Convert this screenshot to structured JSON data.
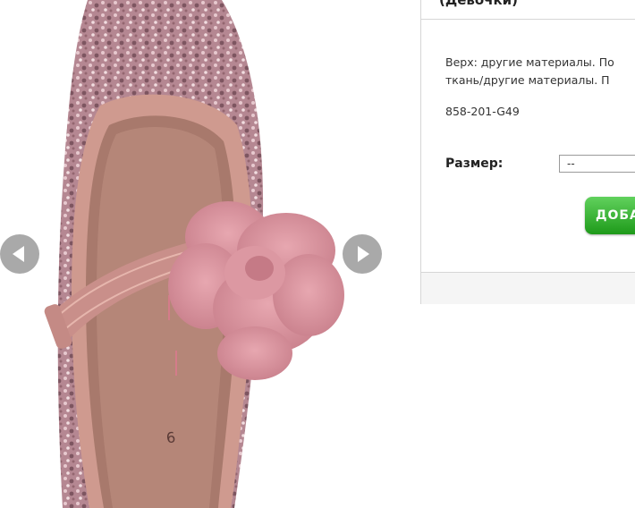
{
  "product": {
    "title": "(Девочки)",
    "description_lines": [
      "Верх: другие материалы. По",
      "ткань/другие материалы. П"
    ],
    "sku": "858-201-G49",
    "size_label": "Размер:",
    "size_selected": "--",
    "add_button_label": "ДОБА"
  },
  "gallery": {
    "insole_mark": "6",
    "prev_icon": "chevron-left-icon",
    "next_icon": "chevron-right-icon"
  },
  "colors": {
    "accent_green": "#2fa82b",
    "nav_arrow": "#a9a9a9",
    "border": "#d6d6d6"
  }
}
